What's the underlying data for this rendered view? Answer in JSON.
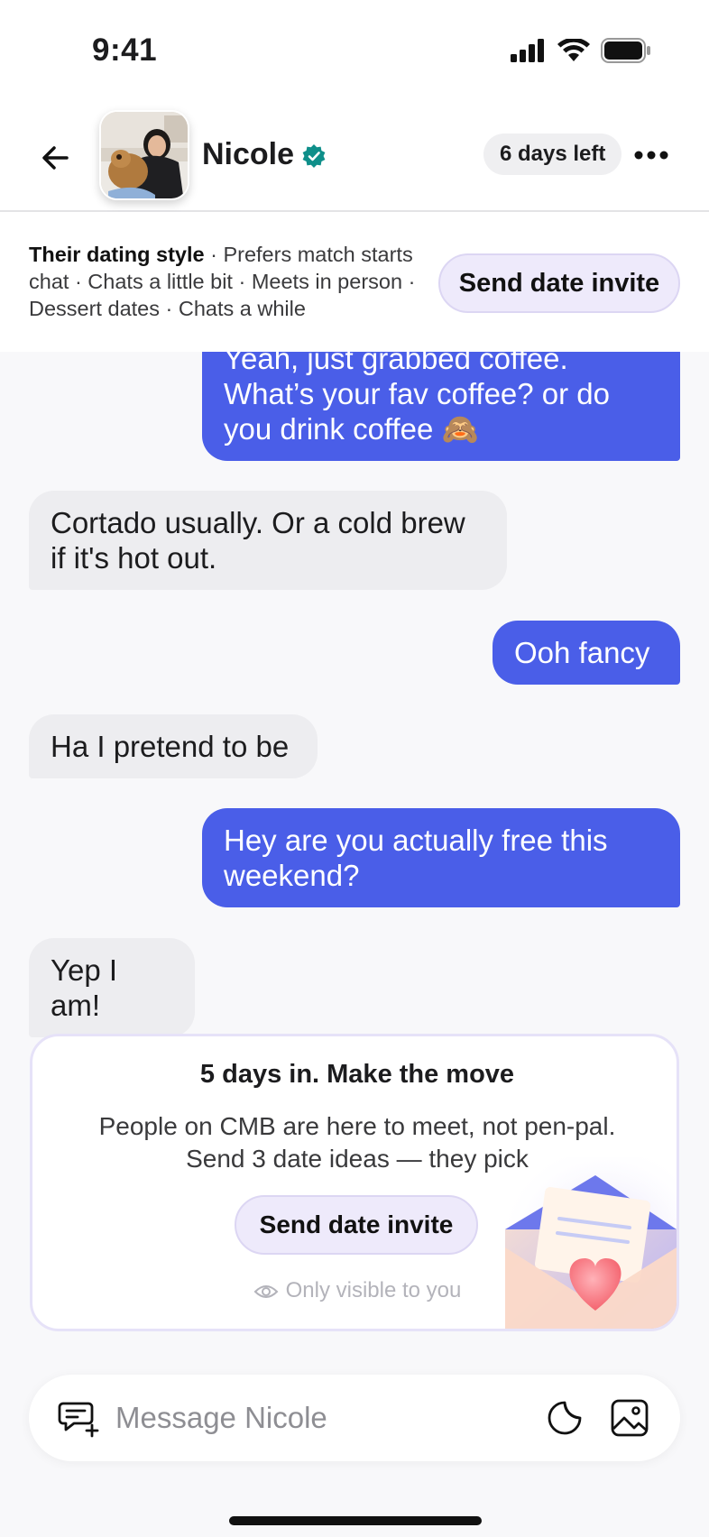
{
  "status_bar": {
    "time": "9:41"
  },
  "header": {
    "name": "Nicole",
    "days_left": "6 days left"
  },
  "dating_style": {
    "label": "Their dating style",
    "traits": " · Prefers match starts chat · Chats a little bit · Meets in person · Dessert dates · Chats a while",
    "button": "Send date invite"
  },
  "messages": [
    {
      "from": "me",
      "lines": [
        "Yeah, just grabbed coffee.",
        "What’s your fav coffee? or do",
        "you drink coffee 🙈"
      ]
    },
    {
      "from": "them",
      "lines": [
        "Cortado usually. Or a cold brew",
        "if it's hot out."
      ]
    },
    {
      "from": "me",
      "lines": [
        "Ooh fancy"
      ]
    },
    {
      "from": "them",
      "lines": [
        "Ha I pretend to be"
      ]
    },
    {
      "from": "me",
      "lines": [
        "Hey are you actually free this",
        "weekend?"
      ]
    },
    {
      "from": "them",
      "lines": [
        "Yep I am!"
      ]
    }
  ],
  "nudge": {
    "title": "5 days in. Make the move",
    "body_line1": "People on CMB are here to meet, not pen-pal.",
    "body_line2": "Send 3 date ideas — they pick",
    "button": "Send date invite",
    "note": "Only visible to you"
  },
  "composer": {
    "placeholder": "Message Nicole"
  },
  "colors": {
    "sent_bubble": "#4a5ee8",
    "received_bubble": "#ededf0",
    "verified_badge": "#0f8f8a",
    "invite_button": "#eeeafb"
  }
}
